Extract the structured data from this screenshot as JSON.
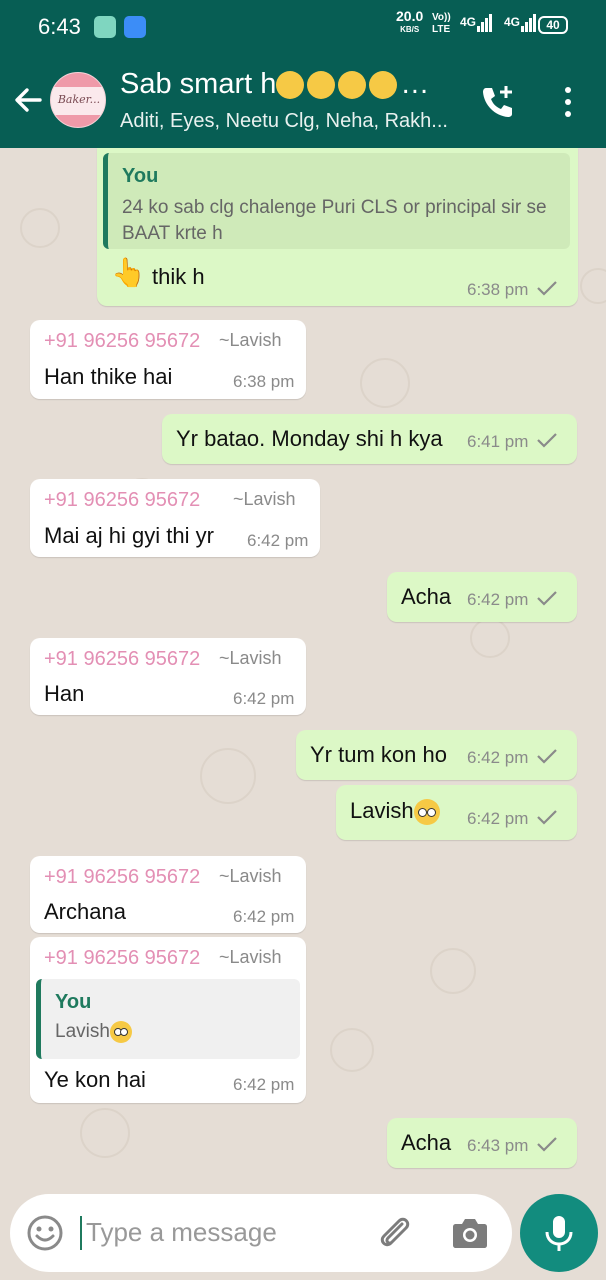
{
  "statusbar": {
    "time": "6:43",
    "speed_value": "20.0",
    "speed_unit": "KB/S",
    "volte_line1": "Vo))",
    "volte_line2": "LTE",
    "network1": "4G",
    "network2": "4G",
    "battery": "40"
  },
  "header": {
    "title": "Sab smart h",
    "subtitle": "Aditi, Eyes, Neetu Clg, Neha, Rakh...",
    "avatar_text": "Baker..."
  },
  "messages": [
    {
      "dir": "out",
      "quoted_name": "You",
      "quoted_text": "24 ko sab clg chalenge Puri CLS or principal sir se BAAT krte h",
      "text": "thik h",
      "time": "6:38 pm"
    },
    {
      "dir": "in",
      "sender": "+91 96256 95672",
      "alias": "~Lavish",
      "text": "Han thike hai",
      "time": "6:38 pm"
    },
    {
      "dir": "out",
      "text": "Yr batao. Monday shi h kya",
      "time": "6:41 pm"
    },
    {
      "dir": "in",
      "sender": "+91 96256 95672",
      "alias": "~Lavish",
      "text": "Mai aj hi gyi thi yr",
      "time": "6:42 pm"
    },
    {
      "dir": "out",
      "text": "Acha",
      "time": "6:42 pm"
    },
    {
      "dir": "in",
      "sender": "+91 96256 95672",
      "alias": "~Lavish",
      "text": "Han",
      "time": "6:42 pm"
    },
    {
      "dir": "out",
      "text": "Yr tum kon ho",
      "time": "6:42 pm"
    },
    {
      "dir": "out",
      "text": "Lavish",
      "time": "6:42 pm"
    },
    {
      "dir": "in",
      "sender": "+91 96256 95672",
      "alias": "~Lavish",
      "text": "Archana",
      "time": "6:42 pm"
    },
    {
      "dir": "in",
      "sender": "+91 96256 95672",
      "alias": "~Lavish",
      "quoted_name": "You",
      "quoted_text": "Lavish",
      "text": "Ye kon hai",
      "time": "6:42 pm"
    },
    {
      "dir": "out",
      "text": "Acha",
      "time": "6:43 pm"
    }
  ],
  "composer": {
    "placeholder": "Type a message"
  },
  "icons": {
    "back": "arrow-back-icon",
    "add_call": "add-call-icon",
    "more": "more-vertical-icon",
    "emoji": "emoji-icon",
    "attach": "paperclip-icon",
    "camera": "camera-icon",
    "mic": "mic-icon",
    "read_tick": "check-icon"
  },
  "colors": {
    "header": "#075e54",
    "outgoing_bubble": "#dcf8c6",
    "incoming_bubble": "#ffffff",
    "sender_name": "#e38fb4",
    "mic_button": "#128c7e"
  }
}
